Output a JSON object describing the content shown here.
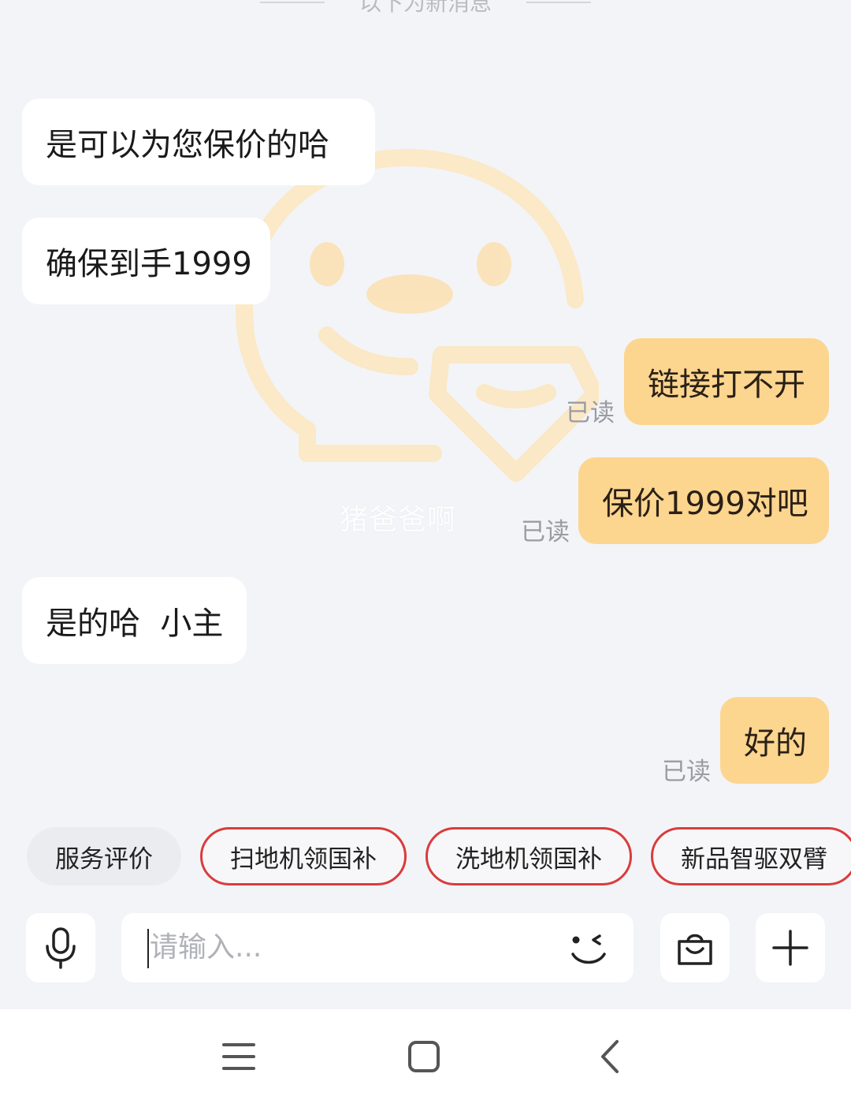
{
  "divider": {
    "label": "以下为新消息"
  },
  "watermark": {
    "name": "猪爸爸啊",
    "icon": "mascot-chat-icon"
  },
  "messages": [
    {
      "side": "incoming",
      "text": "是可以为您保价的哈"
    },
    {
      "side": "incoming",
      "text": "确保到手1999"
    },
    {
      "side": "outgoing",
      "text": "链接打不开",
      "status": "已读"
    },
    {
      "side": "outgoing",
      "text": "保价1999对吧",
      "status": "已读"
    },
    {
      "side": "incoming",
      "text": "是的哈  小主"
    },
    {
      "side": "outgoing",
      "text": "好的",
      "status": "已读"
    }
  ],
  "quick_replies": [
    {
      "label": "服务评价",
      "style": "plain"
    },
    {
      "label": "扫地机领国补",
      "style": "highlight"
    },
    {
      "label": "洗地机领国补",
      "style": "highlight"
    },
    {
      "label": "新品智驱双臂",
      "style": "highlight"
    }
  ],
  "input": {
    "placeholder": "请输入...",
    "left_icon": "microphone-icon",
    "emoji_icon": "wink-emoji-icon",
    "shop_icon": "shopping-bag-icon",
    "more_icon": "plus-icon"
  },
  "system_nav": {
    "icons": [
      "menu-icon",
      "home-icon",
      "back-icon"
    ]
  },
  "colors": {
    "background": "#f3f4f8",
    "incoming_bubble": "#ffffff",
    "outgoing_bubble": "#fcd58f",
    "chip_border": "#d93c3c",
    "read_text": "#9a9ca3"
  }
}
